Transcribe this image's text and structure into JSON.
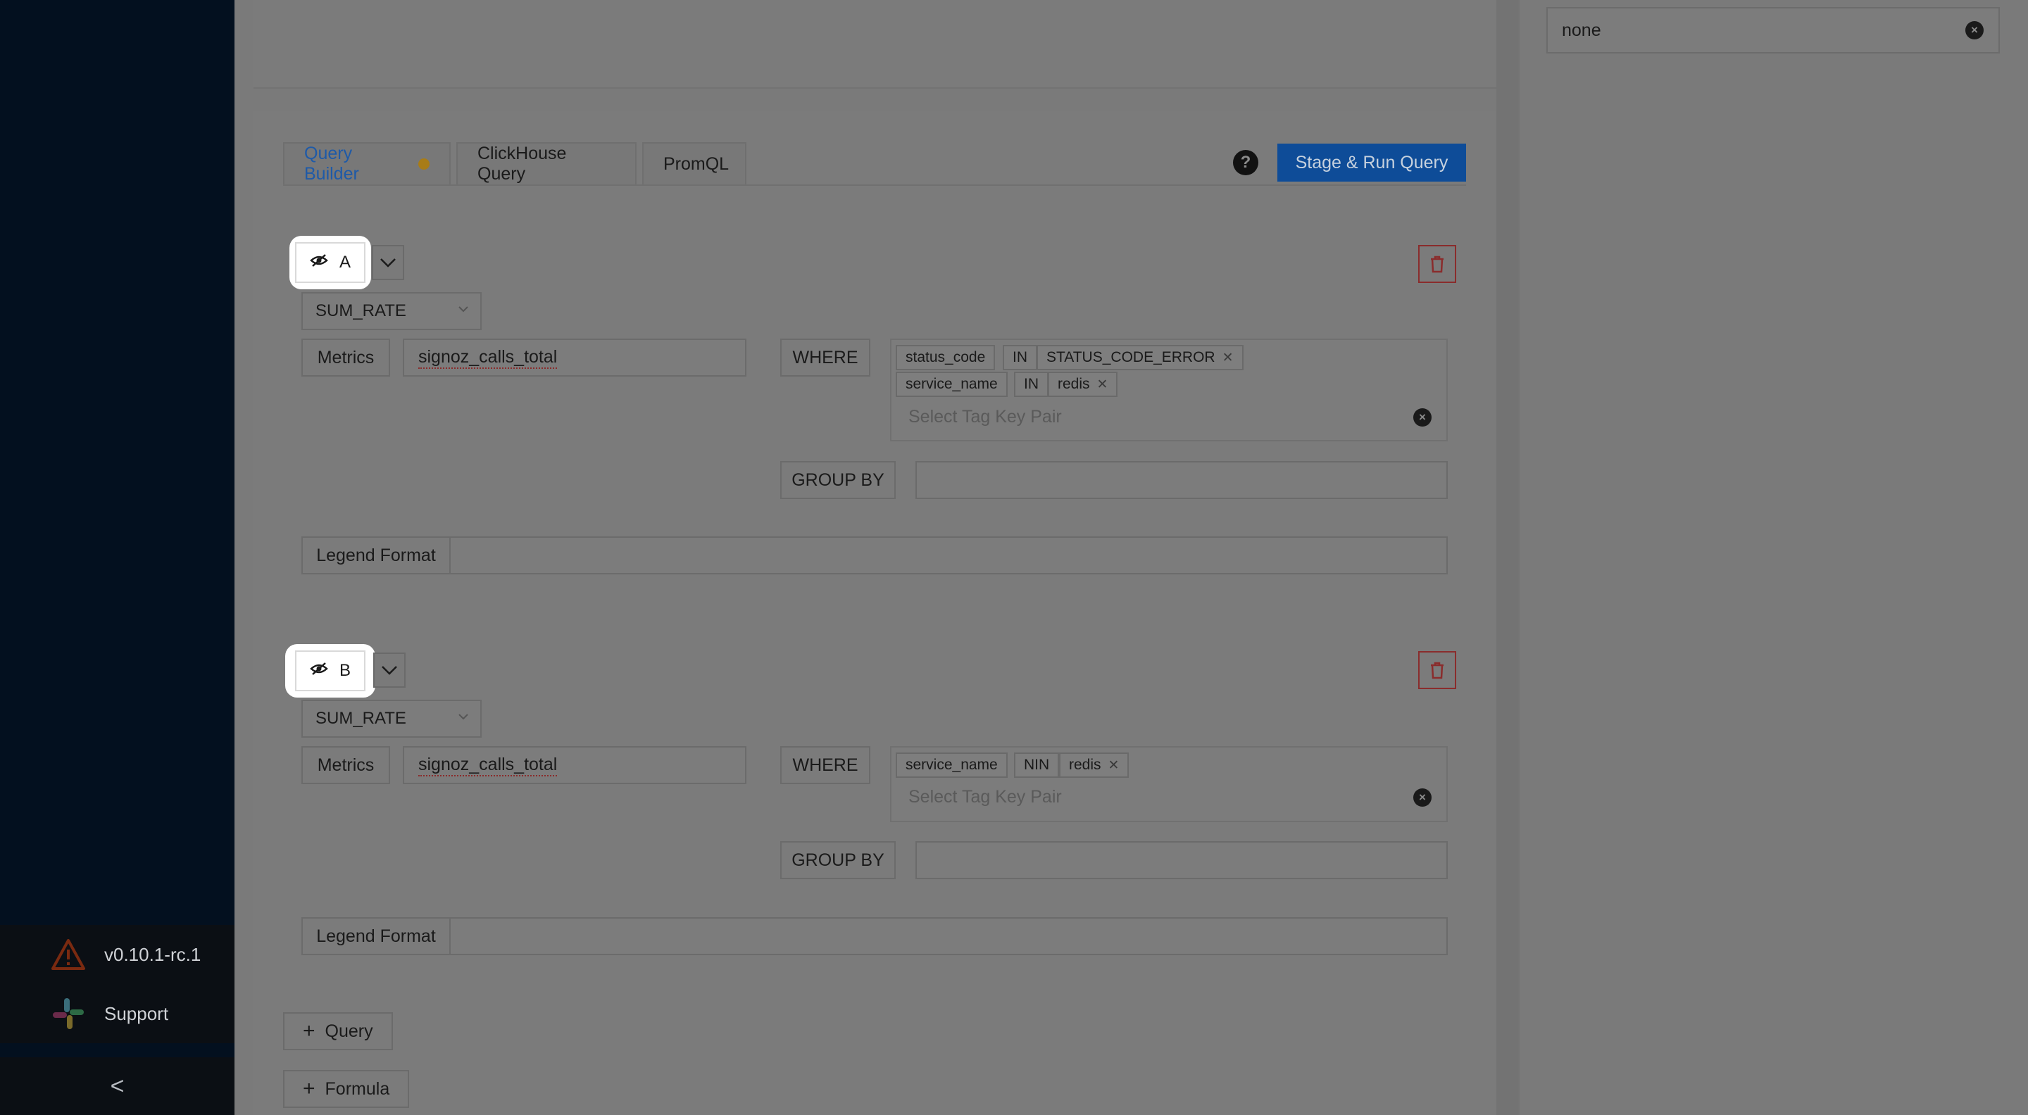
{
  "sidebar": {
    "version_label": "v0.10.1-rc.1",
    "support_label": "Support",
    "collapse_glyph": "<",
    "version_icon": "warning-triangle-icon",
    "support_icon": "slack-icon"
  },
  "right_pane": {
    "select_value": "none",
    "clear_glyph": "×"
  },
  "tabs": [
    {
      "label": "Query Builder",
      "active": true
    },
    {
      "label": "ClickHouse Query",
      "active": false
    },
    {
      "label": "PromQL",
      "active": false
    }
  ],
  "toolbar": {
    "help_glyph": "?",
    "run_label": "Stage & Run Query"
  },
  "queries": [
    {
      "name": "A",
      "aggregation": "SUM_RATE",
      "metrics_label": "Metrics",
      "metric": "signoz_calls_total",
      "where_label": "WHERE",
      "filters": [
        {
          "key": "status_code",
          "op": "IN",
          "value": "STATUS_CODE_ERROR"
        },
        {
          "key": "service_name",
          "op": "IN",
          "value": "redis"
        }
      ],
      "tag_placeholder": "Select Tag Key Pair",
      "group_by_label": "GROUP BY",
      "legend_label": "Legend Format",
      "legend_value": ""
    },
    {
      "name": "B",
      "aggregation": "SUM_RATE",
      "metrics_label": "Metrics",
      "metric": "signoz_calls_total",
      "where_label": "WHERE",
      "filters": [
        {
          "key": "service_name",
          "op": "NIN",
          "value": "redis"
        }
      ],
      "tag_placeholder": "Select Tag Key Pair",
      "group_by_label": "GROUP BY",
      "legend_label": "Legend Format",
      "legend_value": ""
    }
  ],
  "actions": {
    "add_query_label": "Query",
    "add_formula_label": "Formula"
  },
  "colors": {
    "accent": "#1677ff",
    "danger": "#ff4d4f",
    "tab_dot": "#faad14"
  }
}
